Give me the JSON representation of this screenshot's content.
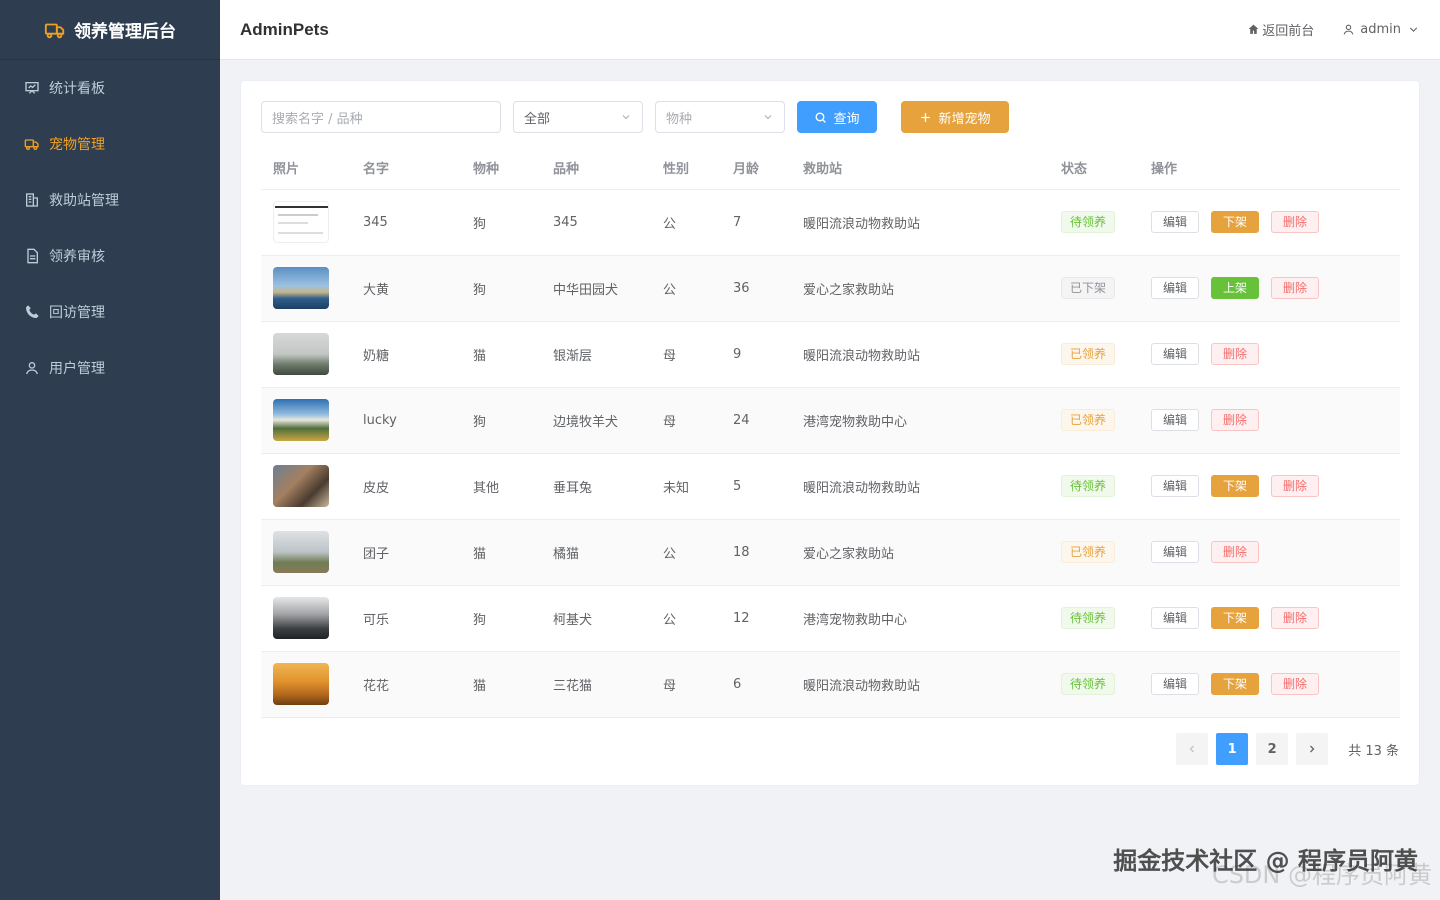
{
  "sidebar": {
    "title": "领养管理后台",
    "items": [
      {
        "label": "统计看板",
        "icon": "presentation-board-icon",
        "active": false
      },
      {
        "label": "宠物管理",
        "icon": "truck-icon",
        "active": true
      },
      {
        "label": "救助站管理",
        "icon": "building-icon",
        "active": false
      },
      {
        "label": "领养审核",
        "icon": "document-icon",
        "active": false
      },
      {
        "label": "回访管理",
        "icon": "phone-icon",
        "active": false
      },
      {
        "label": "用户管理",
        "icon": "user-icon",
        "active": false
      }
    ]
  },
  "header": {
    "title": "AdminPets",
    "back_link": "返回前台",
    "user": "admin"
  },
  "filters": {
    "search_placeholder": "搜索名字 / 品种",
    "status_value": "全部",
    "species_placeholder": "物种",
    "query_label": "查询",
    "add_label": "新增宠物"
  },
  "table": {
    "columns": [
      "照片",
      "名字",
      "物种",
      "品种",
      "性别",
      "月龄",
      "救助站",
      "状态",
      "操作"
    ],
    "rows": [
      {
        "name": "345",
        "species": "狗",
        "breed": "345",
        "gender": "公",
        "age": "7",
        "station": "暖阳流浪动物救助站",
        "status": "待领养",
        "status_type": "success",
        "toggle": "下架",
        "toggle_type": "warning",
        "photo": "screenshot"
      },
      {
        "name": "大黄",
        "species": "狗",
        "breed": "中华田园犬",
        "gender": "公",
        "age": "36",
        "station": "爱心之家救助站",
        "status": "已下架",
        "status_type": "info",
        "toggle": "上架",
        "toggle_type": "success",
        "photo": "sea"
      },
      {
        "name": "奶糖",
        "species": "猫",
        "breed": "银渐层",
        "gender": "母",
        "age": "9",
        "station": "暖阳流浪动物救助站",
        "status": "已领养",
        "status_type": "warning",
        "toggle": "",
        "toggle_type": "",
        "photo": "fog"
      },
      {
        "name": "lucky",
        "species": "狗",
        "breed": "边境牧羊犬",
        "gender": "母",
        "age": "24",
        "station": "港湾宠物救助中心",
        "status": "已领养",
        "status_type": "warning",
        "toggle": "",
        "toggle_type": "",
        "photo": "field"
      },
      {
        "name": "皮皮",
        "species": "其他",
        "breed": "垂耳兔",
        "gender": "未知",
        "age": "5",
        "station": "暖阳流浪动物救助站",
        "status": "待领养",
        "status_type": "success",
        "toggle": "下架",
        "toggle_type": "warning",
        "photo": "bridge"
      },
      {
        "name": "团子",
        "species": "猫",
        "breed": "橘猫",
        "gender": "公",
        "age": "18",
        "station": "爱心之家救助站",
        "status": "已领养",
        "status_type": "warning",
        "toggle": "",
        "toggle_type": "",
        "photo": "meadow"
      },
      {
        "name": "可乐",
        "species": "狗",
        "breed": "柯基犬",
        "gender": "公",
        "age": "12",
        "station": "港湾宠物救助中心",
        "status": "待领养",
        "status_type": "success",
        "toggle": "下架",
        "toggle_type": "warning",
        "photo": "mountain"
      },
      {
        "name": "花花",
        "species": "猫",
        "breed": "三花猫",
        "gender": "母",
        "age": "6",
        "station": "暖阳流浪动物救助站",
        "status": "待领养",
        "status_type": "success",
        "toggle": "下架",
        "toggle_type": "warning",
        "photo": "sunset"
      }
    ],
    "edit_label": "编辑",
    "delete_label": "删除"
  },
  "pagination": {
    "pages": [
      "1",
      "2"
    ],
    "current": "1",
    "total": "共 13 条"
  },
  "watermark": {
    "line1": "掘金技术社区 @ 程序员阿黄",
    "line2": "CSDN @程序员阿黄"
  },
  "colors": {
    "sidebar_bg": "#2e3e50",
    "accent_active": "#f0a020",
    "primary": "#409eff",
    "warning": "#e6a23c",
    "success": "#67c23a",
    "danger": "#f56c6c"
  }
}
